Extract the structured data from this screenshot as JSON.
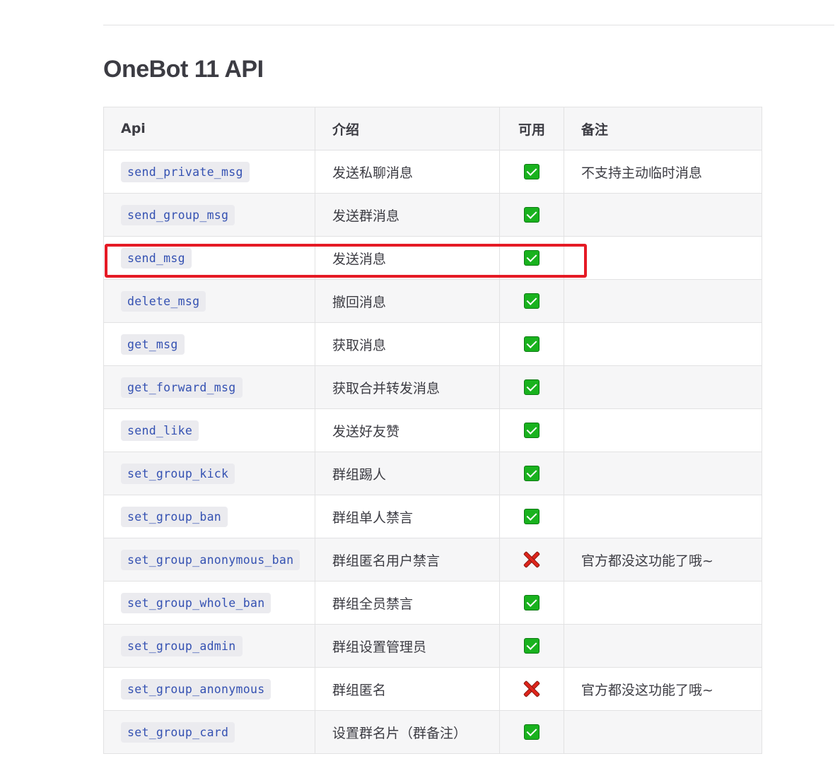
{
  "page": {
    "title": "OneBot 11 API"
  },
  "table": {
    "headers": {
      "api": "Api",
      "desc": "介绍",
      "avail": "可用",
      "note": "备注"
    },
    "rows": [
      {
        "api": "send_private_msg",
        "desc": "发送私聊消息",
        "available": true,
        "note": "不支持主动临时消息"
      },
      {
        "api": "send_group_msg",
        "desc": "发送群消息",
        "available": true,
        "note": ""
      },
      {
        "api": "send_msg",
        "desc": "发送消息",
        "available": true,
        "note": ""
      },
      {
        "api": "delete_msg",
        "desc": "撤回消息",
        "available": true,
        "note": ""
      },
      {
        "api": "get_msg",
        "desc": "获取消息",
        "available": true,
        "note": ""
      },
      {
        "api": "get_forward_msg",
        "desc": "获取合并转发消息",
        "available": true,
        "note": ""
      },
      {
        "api": "send_like",
        "desc": "发送好友赞",
        "available": true,
        "note": ""
      },
      {
        "api": "set_group_kick",
        "desc": "群组踢人",
        "available": true,
        "note": ""
      },
      {
        "api": "set_group_ban",
        "desc": "群组单人禁言",
        "available": true,
        "note": ""
      },
      {
        "api": "set_group_anonymous_ban",
        "desc": "群组匿名用户禁言",
        "available": false,
        "note": "官方都没这功能了哦~"
      },
      {
        "api": "set_group_whole_ban",
        "desc": "群组全员禁言",
        "available": true,
        "note": ""
      },
      {
        "api": "set_group_admin",
        "desc": "群组设置管理员",
        "available": true,
        "note": ""
      },
      {
        "api": "set_group_anonymous",
        "desc": "群组匿名",
        "available": false,
        "note": "官方都没这功能了哦~"
      },
      {
        "api": "set_group_card",
        "desc": "设置群名片（群备注）",
        "available": true,
        "note": ""
      }
    ]
  },
  "icons": {
    "available": "check-mark-icon",
    "unavailable": "cross-mark-icon"
  },
  "colors": {
    "highlight": "#e51a25",
    "code_text": "#3451b2",
    "check": "#19b21e",
    "cross": "#e0241b"
  },
  "highlight": {
    "row_index": 2
  }
}
